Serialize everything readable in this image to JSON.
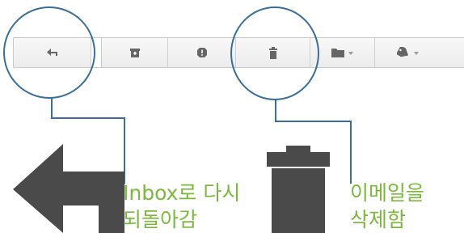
{
  "toolbar": {
    "buttons": [
      {
        "name": "reply-button",
        "icon": "reply-icon"
      },
      {
        "name": "archive-button",
        "icon": "archive-icon"
      },
      {
        "name": "report-spam-button",
        "icon": "exclamation-icon"
      },
      {
        "name": "delete-button",
        "icon": "trash-icon"
      },
      {
        "name": "move-to-button",
        "icon": "folder-icon",
        "has_dropdown": true
      },
      {
        "name": "labels-button",
        "icon": "tag-icon",
        "has_dropdown": true
      }
    ]
  },
  "annotations": {
    "back_to_inbox": {
      "line1": "Inbox로 다시",
      "line2": "되돌아감"
    },
    "delete_email": {
      "line1": "이메일을",
      "line2": "삭제함"
    }
  },
  "colors": {
    "callout": "#3a6f9a",
    "label_text": "#7ab93b",
    "big_icon": "#4a4a4a",
    "toolbar_icon": "#666666"
  }
}
